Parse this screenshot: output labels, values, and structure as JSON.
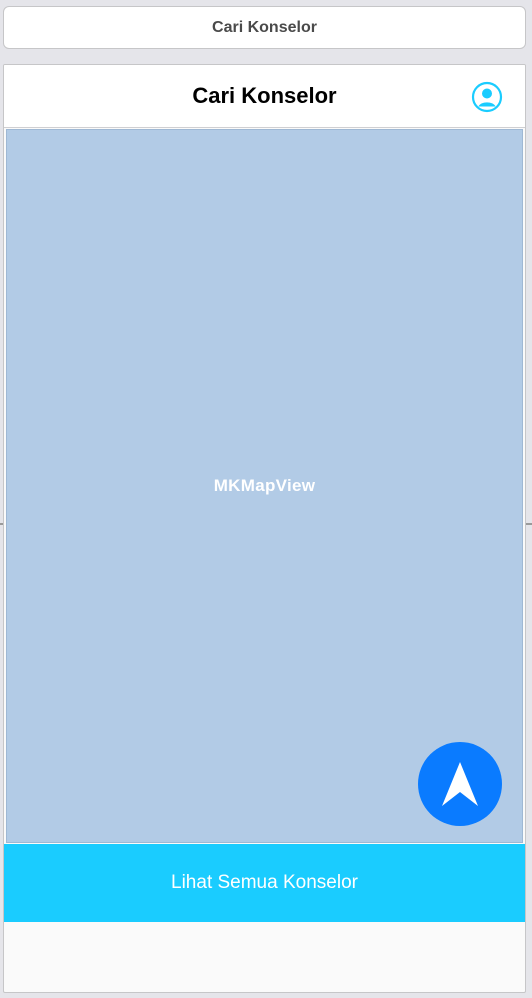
{
  "scene": {
    "title": "Cari Konselor"
  },
  "navbar": {
    "title": "Cari Konselor",
    "profile_icon": "person-circle-icon"
  },
  "map": {
    "label": "MKMapView"
  },
  "locate_button": {
    "icon": "navigation-arrow-icon",
    "color": "#0a7bff"
  },
  "bottom_button": {
    "label": "Lihat Semua Konselor",
    "color": "#1accff"
  },
  "colors": {
    "map_bg": "#b2cbe6",
    "accent": "#1accff"
  }
}
